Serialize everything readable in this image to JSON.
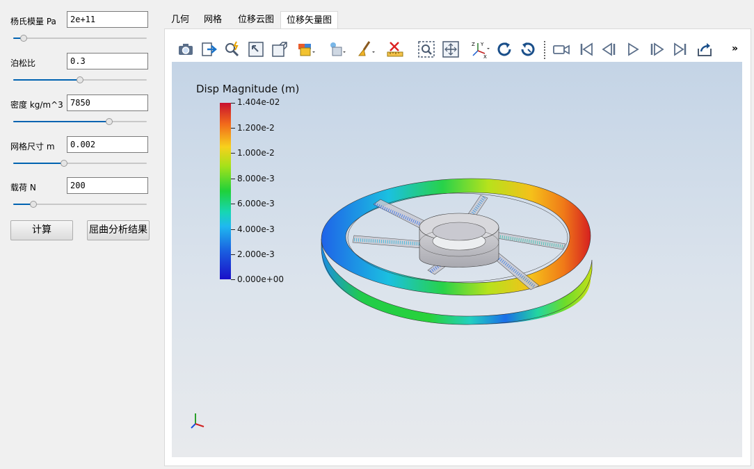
{
  "params": [
    {
      "label": "杨氏模量 Pa",
      "value": "2e+11",
      "slider": 0.08
    },
    {
      "label": "泊松比",
      "value": "0.3",
      "slider": 0.5
    },
    {
      "label": "密度 kg/m^3",
      "value": "7850",
      "slider": 0.72
    },
    {
      "label": "网格尺寸 m",
      "value": "0.002",
      "slider": 0.38
    },
    {
      "label": "载荷 N",
      "value": "200",
      "slider": 0.15
    }
  ],
  "buttons": {
    "compute": "计算",
    "buckling": "屈曲分析结果"
  },
  "tabs": [
    {
      "label": "几何",
      "active": false
    },
    {
      "label": "网格",
      "active": false
    },
    {
      "label": "位移云图",
      "active": false
    },
    {
      "label": "位移矢量图",
      "active": true
    }
  ],
  "toolbar": {
    "icons": [
      "camera-icon",
      "export-icon",
      "interactive-select-icon",
      "select-cells-icon",
      "select-frustum-icon",
      "color-palette-icon",
      "shading-icon",
      "brush-icon",
      "ruler-icon",
      "zoom-box-icon",
      "reset-camera-icon",
      "orientation-axes-icon",
      "rotate-cw-icon",
      "rotate-ccw-icon",
      "video-camera-icon",
      "first-frame-icon",
      "previous-frame-icon",
      "play-icon",
      "next-frame-icon",
      "last-frame-icon",
      "share-icon"
    ],
    "overflow": "»"
  },
  "legend": {
    "title": "Disp Magnitude (m)",
    "labels": [
      "1.404e-02",
      "1.200e-2",
      "1.000e-2",
      "8.000e-3",
      "6.000e-3",
      "4.000e-3",
      "2.000e-3",
      "0.000e+00"
    ],
    "min": 0,
    "max": 0.01404
  }
}
